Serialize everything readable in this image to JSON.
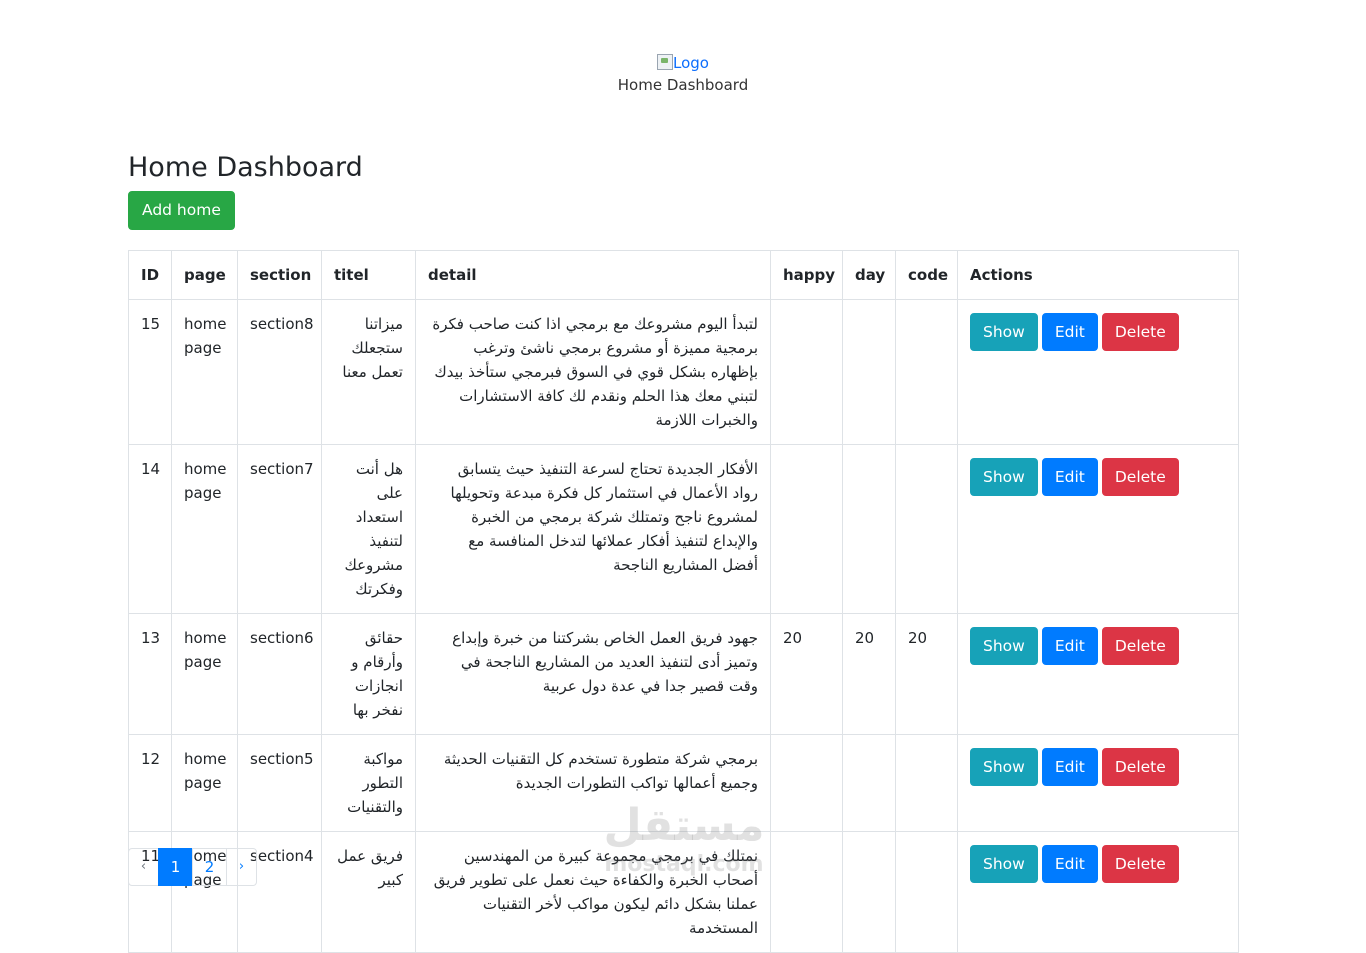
{
  "header": {
    "logo_alt": "Logo",
    "subtitle": "Home Dashboard"
  },
  "main": {
    "title": "Home Dashboard",
    "add_button": "Add home"
  },
  "table": {
    "columns": [
      "ID",
      "page",
      "section",
      "titel",
      "detail",
      "happy",
      "day",
      "code",
      "Actions"
    ],
    "rows": [
      {
        "id": "15",
        "page": "home page",
        "section": "section8",
        "titel": "ميزاتنا ستجعلك تعمل معنا",
        "detail": "لتبدأ اليوم مشروعك مع برمجي اذا كنت صاحب فكرة برمجية مميزة أو مشروع برمجي ناشئ وترغب بإظهاره بشكل قوي في السوق فبرمجي ستأخذ بيدك لتبني معك هذا الحلم ونقدم لك كافة الاستشارات والخبرات اللازمة",
        "happy": "",
        "day": "",
        "code": ""
      },
      {
        "id": "14",
        "page": "home page",
        "section": "section7",
        "titel": "هل أنت على استعداد لتنفيذ مشروعك وفكرتك",
        "detail": "الأفكار الجديدة تحتاج لسرعة التنفيذ حيث يتسابق رواد الأعمال في استثمار كل فكرة مبدعة وتحويلها لمشروع ناجح وتمتلك شركة برمجي من الخبرة والإبداع لتنفيذ أفكار عملائها لتدخل المنافسة مع أفضل المشاريع الناجحة",
        "happy": "",
        "day": "",
        "code": ""
      },
      {
        "id": "13",
        "page": "home page",
        "section": "section6",
        "titel": "حقائق وأرقام و انجازات نفخر بها",
        "detail": "جهود فريق العمل الخاص بشركتنا من خبرة وإبداع وتميز أدى لتنفيذ العديد من المشاريع الناجحة في وقت قصير جدا في عدة دول عربية",
        "happy": "20",
        "day": "20",
        "code": "20"
      },
      {
        "id": "12",
        "page": "home page",
        "section": "section5",
        "titel": "مواكبة التطور والتقنيات",
        "detail": "برمجي شركة متطورة تستخدم كل التقنيات الحديثة وجميع أعمالها تواكب التطورات الجديدة",
        "happy": "",
        "day": "",
        "code": ""
      },
      {
        "id": "11",
        "page": "home page",
        "section": "section4",
        "titel": "فريق عمل كبير",
        "detail": "نمتلك في برمجي مجموعة كبيرة من المهندسين أصحاب الخبرة والكفاءة حيث نعمل على تطوير فريق عملنا بشكل دائم ليكون مواكب لأخر التقنيات المستخدمة",
        "happy": "",
        "day": "",
        "code": ""
      }
    ],
    "actions": {
      "show": "Show",
      "edit": "Edit",
      "delete": "Delete"
    }
  },
  "pagination": {
    "prev": "‹",
    "pages": [
      "1",
      "2"
    ],
    "active_page": "1",
    "next": "›"
  },
  "watermark": {
    "arabic": "مستقل",
    "latin": "mostaql.com"
  },
  "colors": {
    "success": "#28a745",
    "info": "#17a2b8",
    "primary": "#007bff",
    "danger": "#dc3545"
  }
}
